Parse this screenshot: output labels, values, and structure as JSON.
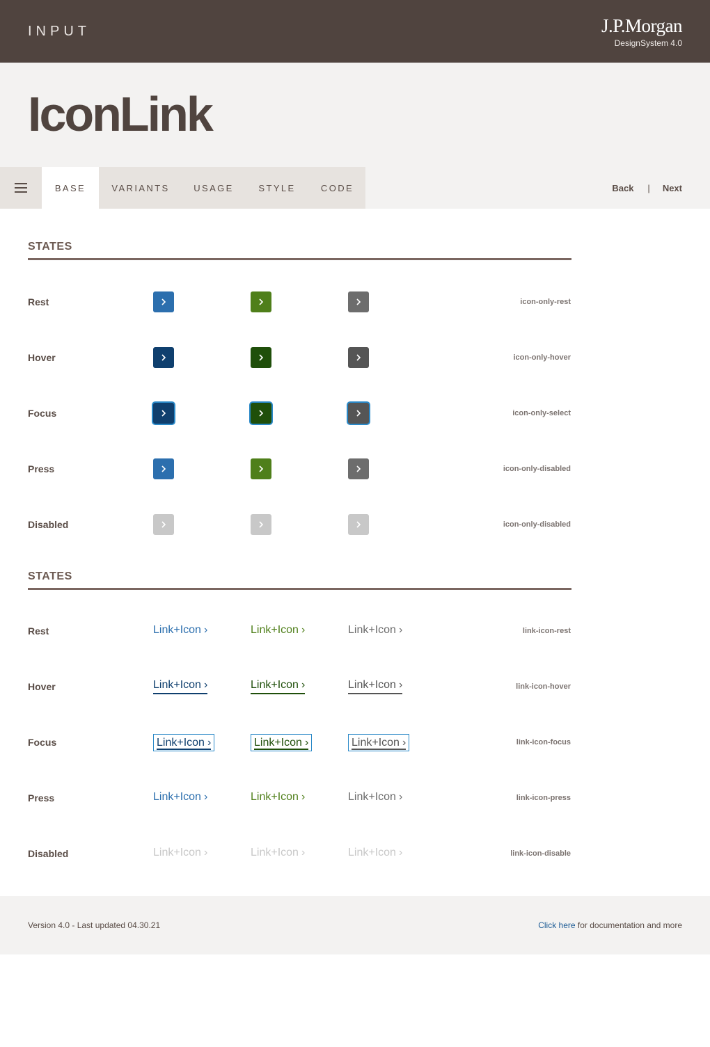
{
  "header": {
    "category": "INPUT",
    "brand_logo": "J.P.Morgan",
    "brand_sub": "DesignSystem 4.0"
  },
  "page_title": "IconLink",
  "tabs": [
    {
      "label": "BASE",
      "active": true
    },
    {
      "label": "VARIANTS",
      "active": false
    },
    {
      "label": "USAGE",
      "active": false
    },
    {
      "label": "STYLE",
      "active": false
    },
    {
      "label": "CODE",
      "active": false
    }
  ],
  "pager": {
    "back": "Back",
    "separator": "|",
    "next": "Next"
  },
  "icon_section": {
    "title": "STATES",
    "rows": [
      {
        "label": "Rest",
        "token": "icon-only-rest",
        "colors": [
          "#2c6fae",
          "#4f7f1a",
          "#6d6d6d"
        ]
      },
      {
        "label": "Hover",
        "token": "icon-only-hover",
        "colors": [
          "#0f3f6e",
          "#1f4f0a",
          "#555555"
        ]
      },
      {
        "label": "Focus",
        "token": "icon-only-select",
        "colors": [
          "#0f3f6e",
          "#1f4f0a",
          "#555555"
        ]
      },
      {
        "label": "Press",
        "token": "icon-only-disabled",
        "colors": [
          "#2c6fae",
          "#4f7f1a",
          "#6d6d6d"
        ]
      },
      {
        "label": "Disabled",
        "token": "icon-only-disabled",
        "colors": [
          "#c8c8c8",
          "#c8c8c8",
          "#c8c8c8"
        ]
      }
    ]
  },
  "link_section": {
    "title": "STATES",
    "link_text": "Link+Icon",
    "chevron": "›",
    "rows": [
      {
        "label": "Rest",
        "token": "link-icon-rest",
        "colors": [
          "#2c6fae",
          "#4f7f1a",
          "#6d6d6d"
        ]
      },
      {
        "label": "Hover",
        "token": "link-icon-hover",
        "colors": [
          "#0f3f6e",
          "#1f4f0a",
          "#555555"
        ]
      },
      {
        "label": "Focus",
        "token": "link-icon-focus",
        "colors": [
          "#0f3f6e",
          "#1f4f0a",
          "#555555"
        ]
      },
      {
        "label": "Press",
        "token": "link-icon-press",
        "colors": [
          "#2c6fae",
          "#4f7f1a",
          "#6d6d6d"
        ]
      },
      {
        "label": "Disabled",
        "token": "link-icon-disable",
        "colors": [
          "#c8c8c8",
          "#c8c8c8",
          "#c8c8c8"
        ]
      }
    ]
  },
  "footer": {
    "version": "Version 4.0 - Last updated 04.30.21",
    "click_here": "Click here",
    "more": " for documentation and more"
  }
}
